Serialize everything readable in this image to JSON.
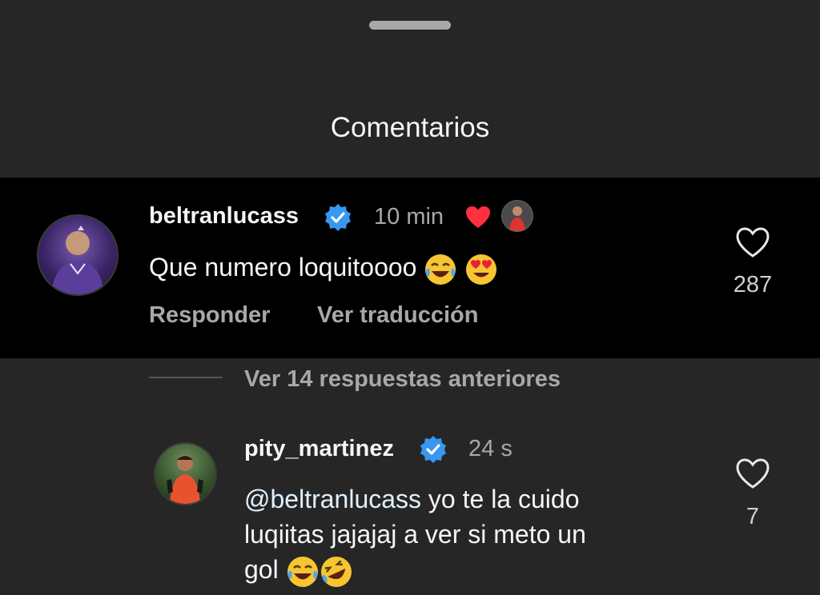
{
  "sheet": {
    "title": "Comentarios"
  },
  "comment1": {
    "username": "beltranlucass",
    "time": "10 min",
    "text": "Que numero loquitoooo",
    "reply_label": "Responder",
    "translate_label": "Ver traducción",
    "likes": "287"
  },
  "thread": {
    "view_replies": "Ver 14 respuestas anteriores"
  },
  "comment2": {
    "username": "pity_martinez",
    "time": "24 s",
    "mention": "@beltranlucass",
    "text_line1_rest": " yo te la cuido",
    "text_line2": "luqiitas jajajaj a ver si meto un",
    "text_line3": "gol",
    "likes": "7"
  },
  "colors": {
    "background": "#262626",
    "highlight": "#000000",
    "verified": "#3897f0",
    "heart_red": "#ff3040",
    "muted_text": "#a8a8a8"
  }
}
